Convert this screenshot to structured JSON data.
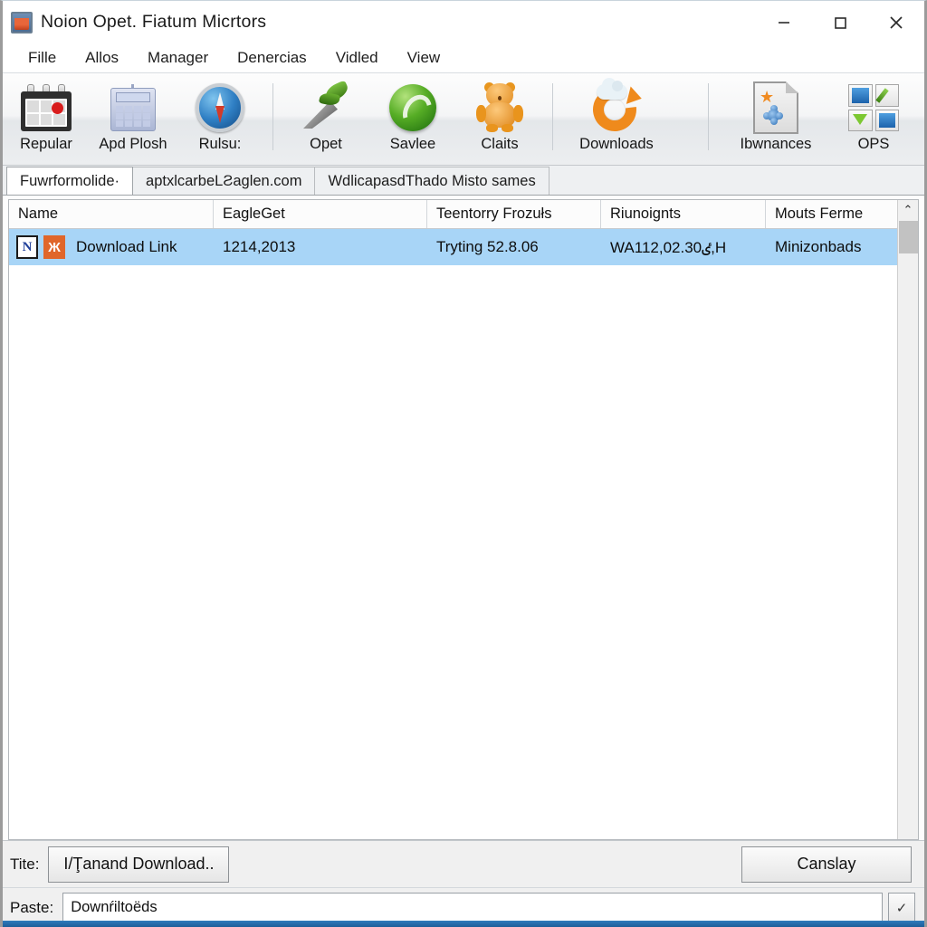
{
  "window": {
    "title": "Noion Opet. Fiatum Micrtors",
    "icon": "app-window-icon",
    "controls": {
      "minimize": "–",
      "maximize": "□",
      "close": "×"
    }
  },
  "menu": {
    "items": [
      {
        "label": "Fille"
      },
      {
        "label": "Allos"
      },
      {
        "label": "Manager"
      },
      {
        "label": "Denercias"
      },
      {
        "label": "Vidled"
      },
      {
        "label": "View"
      }
    ]
  },
  "toolbar": {
    "groups": [
      {
        "items": [
          {
            "label": "Repular",
            "icon": "calendar-icon"
          },
          {
            "label": "Apd Plosh",
            "icon": "keypad-icon"
          },
          {
            "label": "Rulsu:",
            "icon": "compass-icon"
          }
        ]
      },
      {
        "items": [
          {
            "label": "Opet",
            "icon": "pen-icon"
          },
          {
            "label": "Savlee",
            "icon": "green-orb-icon"
          },
          {
            "label": "Claits",
            "icon": "bear-icon"
          }
        ]
      },
      {
        "items": [
          {
            "label": "Downloads",
            "icon": "downloads-refresh-icon"
          }
        ]
      },
      {
        "items": [
          {
            "label": "Ibwnances",
            "icon": "page-plugin-icon"
          },
          {
            "label": "OPS",
            "icon": "ops-grid-icon"
          }
        ]
      }
    ]
  },
  "tabs": [
    {
      "label": "Fuwrformolide·",
      "active": true
    },
    {
      "label": "aptxlcarbeLƧaglen.com",
      "active": false
    },
    {
      "label": "WdlicapasdThado Misto sames",
      "active": false
    }
  ],
  "list": {
    "columns": [
      {
        "label": "Name"
      },
      {
        "label": "EagleGet"
      },
      {
        "label": "Teentorry Frozułs"
      },
      {
        "label": "Riunoignts"
      },
      {
        "label": "Mouts Ferme"
      }
    ],
    "rows": [
      {
        "icons": [
          "netscape-n-icon",
          "orange-question-icon"
        ],
        "name": "Download Link",
        "eagleget": "1214,2013",
        "teentorry": "Tryting 52.8.06",
        "riunoignts": "WAٸ112,02.30,H",
        "mouts": "Minizonbads",
        "selected": true
      }
    ]
  },
  "scrollbar": {
    "up_arrow": "⌃"
  },
  "bottom": {
    "title_label": "Tite:",
    "download_button": "I/Ţanand Download..",
    "cancel_button": "Canslay",
    "paste_label": "Paste:",
    "paste_value": "Downŕiltoëds",
    "paste_button": "✓"
  },
  "colors": {
    "selection": "#a8d5f7",
    "accent_orange": "#ef8a1c",
    "status_strip": "#2f7bbd",
    "toolbar_bg": "#eceef0"
  }
}
